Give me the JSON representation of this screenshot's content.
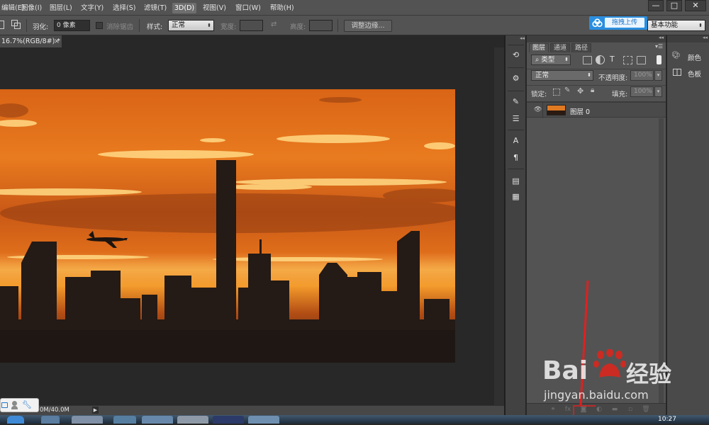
{
  "menubar": {
    "items": [
      "编辑(E)",
      "图像(I)",
      "图层(L)",
      "文字(Y)",
      "选择(S)",
      "滤镜(T)",
      "3D(D)",
      "视图(V)",
      "窗口(W)",
      "帮助(H)"
    ],
    "active_index": 6,
    "window_controls": [
      "—",
      "□",
      "✕"
    ]
  },
  "options": {
    "feather_label": "羽化:",
    "feather_value": "0 像素",
    "antialias_label": "消除锯齿",
    "style_label": "样式:",
    "style_value": "正常",
    "width_label": "宽度:",
    "height_label": "高度:",
    "refine_button": "调整边缘...",
    "workspace_value": "基本功能"
  },
  "upload": {
    "label": "拖拽上传"
  },
  "document": {
    "tab_title": "16.7%(RGB/8#) *",
    "close": "×",
    "status_text": "0M/40.0M"
  },
  "layers_panel": {
    "tabs": [
      "图层",
      "通道",
      "路径"
    ],
    "active_tab": 0,
    "filter_value": "类型",
    "filter_icons": [
      "image-filter-icon",
      "adjustment-filter-icon",
      "type-filter-icon",
      "shape-filter-icon",
      "smart-object-filter-icon"
    ],
    "blend_mode": "正常",
    "opacity_label": "不透明度:",
    "opacity_value": "100%",
    "lock_label": "锁定:",
    "fill_label": "填充:",
    "fill_value": "100%",
    "layers": [
      {
        "name": "图层 0",
        "visible": true
      }
    ],
    "bottom_icons": [
      "link-layers-icon",
      "fx-icon",
      "add-mask-icon",
      "new-fill-adjustment-icon",
      "new-group-icon",
      "new-layer-icon",
      "delete-layer-icon"
    ]
  },
  "swatch_panel": {
    "items": [
      {
        "label": "颜色",
        "icon": "palette-icon"
      },
      {
        "label": "色板",
        "icon": "swatches-icon"
      }
    ]
  },
  "watermark": {
    "brand": "Bai",
    "brand_suffix": "du",
    "cn": "经验",
    "url": "jingyan.baidu.com"
  },
  "clock": "10:27",
  "colors": {
    "accent_red": "#e02020",
    "upload_blue": "#2a8ee0",
    "baidu_red": "#e1251b",
    "ui_panel": "#535353"
  }
}
